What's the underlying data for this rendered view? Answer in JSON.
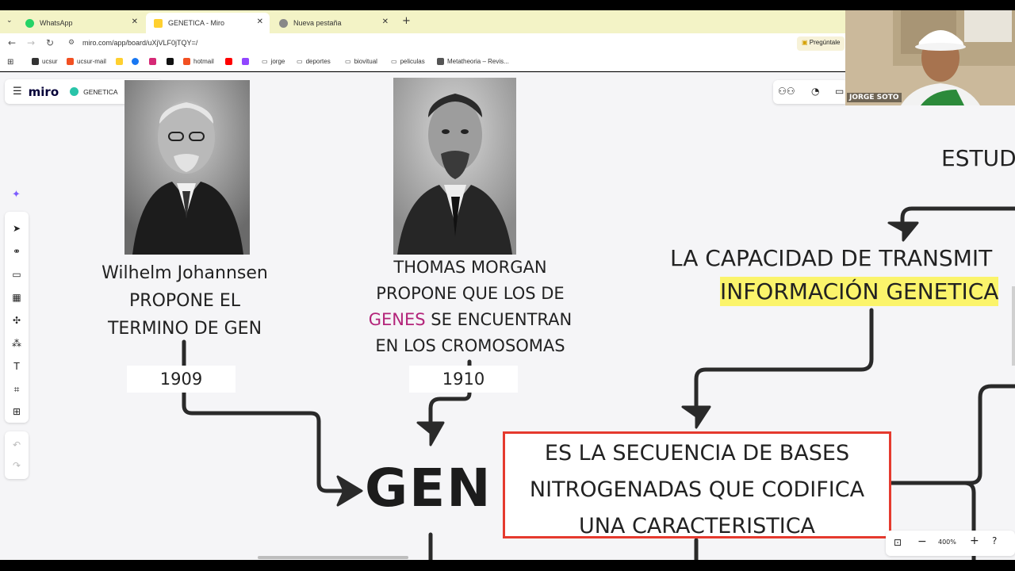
{
  "browser": {
    "tabs": [
      {
        "label": "WhatsApp",
        "icon": "whatsapp-icon",
        "color": "#25d366"
      },
      {
        "label": "GENETICA - Miro",
        "icon": "miro-icon",
        "color": "#ffd02f"
      },
      {
        "label": "Nueva pestaña",
        "icon": "chrome-icon",
        "color": "#888888"
      }
    ],
    "url": "miro.com/app/board/uXjVLF0jTQY=/",
    "ask_label": "Pregúntale",
    "bookmarks": [
      "ucsur",
      "ucsur-mail",
      "hotmail",
      "jorge",
      "deportes",
      "biovitual",
      "peliculas",
      "Metatheoria – Revis..."
    ]
  },
  "miro": {
    "logo": "miro",
    "board_name": "GENETICA",
    "zoom": "400%"
  },
  "board": {
    "johannsen_caption": [
      "Wilhelm Johannsen",
      "PROPONE EL",
      "TERMINO DE GEN"
    ],
    "year1": "1909",
    "morgan_line1": "THOMAS MORGAN",
    "morgan_line2": "PROPONE QUE LOS DE",
    "morgan_genes": "GENES",
    "morgan_line3_rest": " SE ENCUENTRAN",
    "morgan_line4": "EN LOS CROMOSOMAS",
    "year2": "1910",
    "gen_title": "GEN",
    "definition": [
      "ES LA SECUENCIA DE BASES",
      "NITROGENADAS QUE CODIFICA",
      "UNA CARACTERISTICA"
    ],
    "estud": "ESTUD",
    "capacidad": "LA CAPACIDAD DE TRANSMIT",
    "informacion": "INFORMACIÓN GENETICA"
  },
  "webcam": {
    "name": "JORGE SOTO"
  },
  "colors": {
    "highlight": "#fbf46b",
    "genes_text": "#b3247a",
    "box_border": "#e53a2e"
  }
}
